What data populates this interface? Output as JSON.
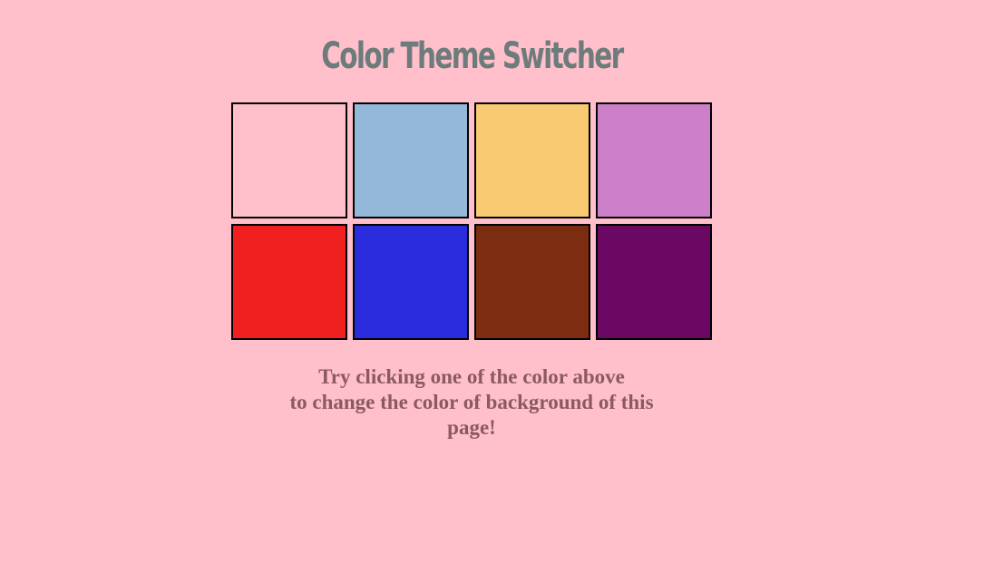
{
  "page": {
    "title": "Color Theme Switcher",
    "background_color": "#ffc0cb",
    "title_color": "#6e7b7b",
    "message_color": "#8b5a5f"
  },
  "swatches": [
    {
      "color": "#ffc0cb"
    },
    {
      "color": "#93b8d8"
    },
    {
      "color": "#f9ca71"
    },
    {
      "color": "#cc80c9"
    },
    {
      "color": "#f02020"
    },
    {
      "color": "#2c2cdf"
    },
    {
      "color": "#7c2c11"
    },
    {
      "color": "#6a0864"
    }
  ],
  "message": {
    "line1": "Try clicking one of the color above",
    "line2": "to change the color of background of this",
    "line3": "page!"
  }
}
